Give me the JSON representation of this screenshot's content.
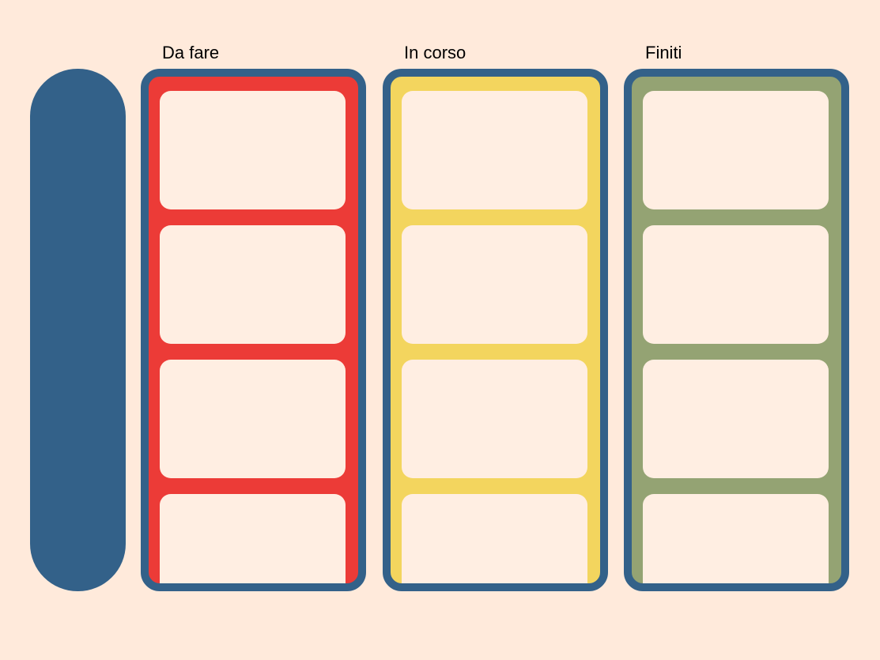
{
  "board": {
    "background_color": "#FFEADB",
    "sidebar_color": "#336189",
    "columns": [
      {
        "title": "Da fare",
        "color": "#EC3B37",
        "card_count": 4
      },
      {
        "title": "In corso",
        "color": "#F3D55E",
        "card_count": 4
      },
      {
        "title": "Finiti",
        "color": "#94A373",
        "card_count": 4
      }
    ],
    "card_color": "#FFEEE2"
  }
}
